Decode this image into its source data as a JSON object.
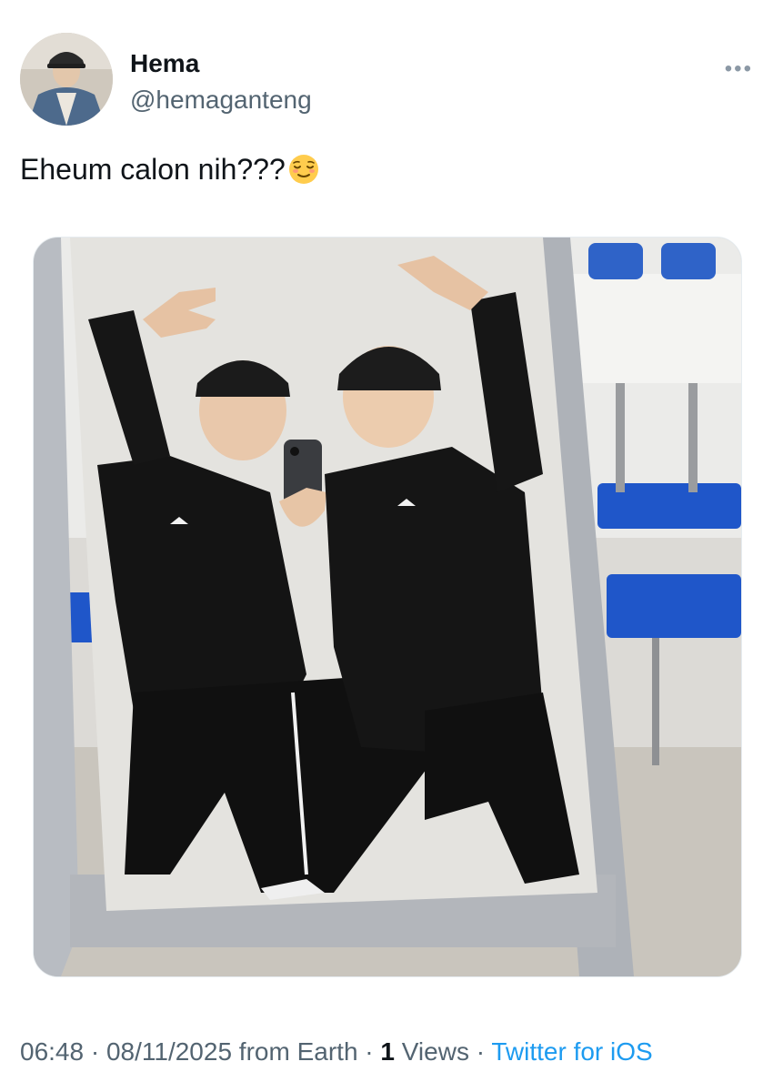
{
  "author": {
    "display_name": "Hema",
    "handle": "@hemaganteng"
  },
  "more_icon": "more-horizontal-icon",
  "tweet": {
    "text": "Eheum calon nih???",
    "emoji_name": "relieved-face-emoji"
  },
  "media": {
    "icon": "photo"
  },
  "meta": {
    "time": "06:48",
    "sep1": " · ",
    "date": "08/11/2025",
    "location": " from Earth",
    "sep2": " · ",
    "view_count": "1",
    "views_label": " Views",
    "sep3": " · ",
    "source": "Twitter for iOS"
  },
  "colors": {
    "text_primary": "#0f1419",
    "text_secondary": "#536471",
    "link": "#1d9bf0"
  }
}
